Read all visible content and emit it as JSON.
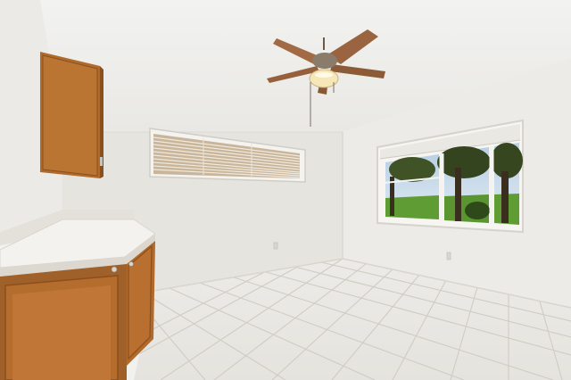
{
  "scene": {
    "description_tag": "empty-room-interior",
    "colors": {
      "ceiling": "#efefed",
      "left_wall": "#ecebe7",
      "back_wall": "#e7e5e0",
      "right_wall": "#eceae6",
      "floor_tile": "#e9e7e2",
      "grout": "#cfccc5",
      "cabinet_wood": "#b06a2b",
      "cabinet_dark": "#8b4f1c",
      "countertop": "#f4f2ee",
      "fan_blade": "#9a6440",
      "fan_light": "#f6e7b8",
      "grass": "#5f9c33",
      "tree": "#34441e",
      "sky": "#c9dbe9"
    },
    "icons": [
      "ceiling-fan-icon",
      "window-blind-icon"
    ]
  }
}
